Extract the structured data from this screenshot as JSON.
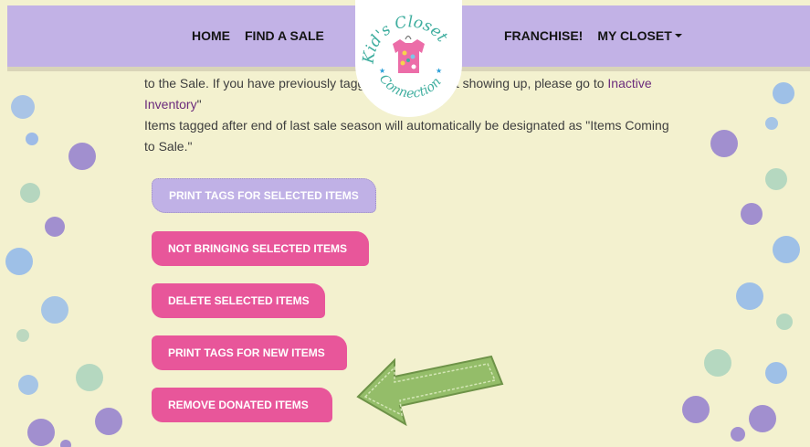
{
  "nav": {
    "home": "HOME",
    "find_sale": "FIND A SALE",
    "franchise": "FRANCHISE!",
    "my_closet": "MY CLOSET"
  },
  "logo": {
    "line1": "Kid's Closet",
    "line2": "Connection"
  },
  "content": {
    "text_part1": "to the Sale. If you have previously tagg",
    "text_part2": "not showing up, please go to",
    "inactive_link": "Inactive Inventory",
    "quote_close": "\"",
    "paragraph2": "Items tagged after end of last sale season will automatically be designated as \"Items Coming to Sale.\""
  },
  "buttons": {
    "print_selected": "PRINT TAGS FOR SELECTED ITEMS",
    "not_bringing": "NOT BRINGING SELECTED ITEMS",
    "delete_selected": "DELETE SELECTED ITEMS",
    "print_new": "PRINT TAGS FOR NEW ITEMS",
    "remove_donated": "REMOVE DONATED ITEMS"
  },
  "colors": {
    "background": "#f3f1cf",
    "navbar": "#c2b2e6",
    "primary_button": "#c0b1e6",
    "action_button": "#e8569a",
    "link": "#6b2b7c",
    "arrow": "#9bc46d",
    "logo_teal": "#3fae9f",
    "logo_shirt": "#ec6da8"
  }
}
